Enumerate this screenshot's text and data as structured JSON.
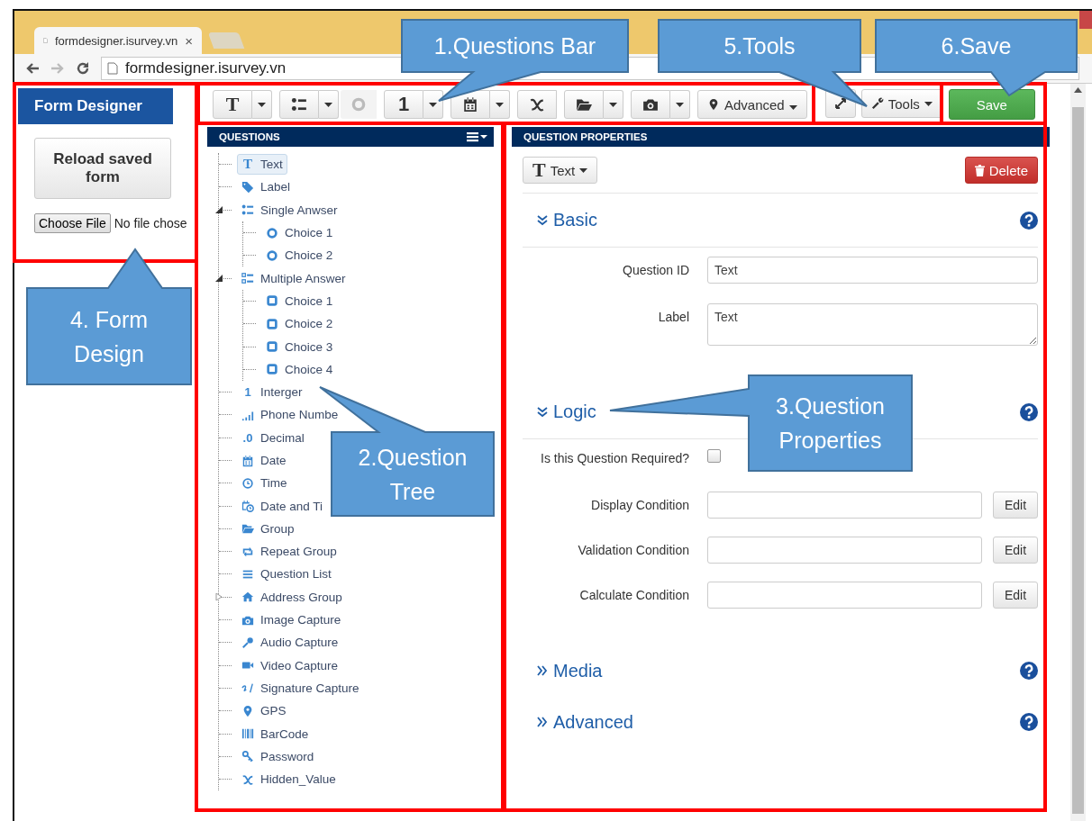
{
  "browser": {
    "tab_title": "formdesigner.isurvey.vn",
    "tab_close": "×",
    "address": "formdesigner.isurvey.vn"
  },
  "sidebar": {
    "title": "Form Designer",
    "reload_button": "Reload saved form",
    "file_button": "Choose File",
    "file_status": "No file chose"
  },
  "toolbar": {
    "buttons": [
      {
        "kind": "text",
        "glyph": "T",
        "dropdown": true,
        "disabled": false
      },
      {
        "kind": "single",
        "dropdown": true,
        "disabled": false
      },
      {
        "kind": "radio",
        "dropdown": false,
        "disabled": true
      },
      {
        "kind": "integer",
        "glyph": "1",
        "dropdown": true,
        "disabled": false
      },
      {
        "kind": "date",
        "dropdown": true,
        "disabled": false
      },
      {
        "kind": "hidden",
        "dropdown": false,
        "disabled": false
      },
      {
        "kind": "group",
        "dropdown": true,
        "disabled": false
      },
      {
        "kind": "image",
        "dropdown": true,
        "disabled": false
      },
      {
        "kind": "gps",
        "label": "Advanced",
        "dropdown": true,
        "disabled": false
      }
    ],
    "tools_label": "Tools",
    "save_label": "Save"
  },
  "questions": {
    "title": "QUESTIONS",
    "items": [
      {
        "kind": "text",
        "glyph": "T",
        "label": "Text",
        "selected": true
      },
      {
        "kind": "label",
        "label": "Label",
        "selected": false
      },
      {
        "kind": "single",
        "label": "Single Anwser",
        "selected": false,
        "expanded": true,
        "children": [
          {
            "kind": "radio",
            "label": "Choice 1",
            "selected": false
          },
          {
            "kind": "radio",
            "label": "Choice 2",
            "selected": false
          }
        ]
      },
      {
        "kind": "multiple",
        "label": "Multiple Answer",
        "selected": false,
        "expanded": true,
        "children": [
          {
            "kind": "checkbox",
            "label": "Choice 1",
            "selected": false
          },
          {
            "kind": "checkbox",
            "label": "Choice 2",
            "selected": false
          },
          {
            "kind": "checkbox",
            "label": "Choice 3",
            "selected": false
          },
          {
            "kind": "checkbox",
            "label": "Choice 4",
            "selected": false
          }
        ]
      },
      {
        "kind": "integer",
        "glyph": "1",
        "label": "Interger",
        "selected": false
      },
      {
        "kind": "phone",
        "label": "Phone Numbe",
        "selected": false
      },
      {
        "kind": "decimal",
        "glyph": ".0",
        "label": "Decimal",
        "selected": false
      },
      {
        "kind": "date",
        "label": "Date",
        "selected": false
      },
      {
        "kind": "time",
        "label": "Time",
        "selected": false
      },
      {
        "kind": "datetime",
        "label": "Date and Ti",
        "selected": false
      },
      {
        "kind": "group",
        "label": "Group",
        "selected": false
      },
      {
        "kind": "repeat",
        "label": "Repeat Group",
        "selected": false
      },
      {
        "kind": "list",
        "label": "Question List",
        "selected": false
      },
      {
        "kind": "address",
        "label": "Address Group",
        "selected": false,
        "expanded": false
      },
      {
        "kind": "image",
        "label": "Image Capture",
        "selected": false
      },
      {
        "kind": "audio",
        "label": "Audio Capture",
        "selected": false
      },
      {
        "kind": "video",
        "label": "Video Capture",
        "selected": false
      },
      {
        "kind": "signature",
        "label": "Signature Capture",
        "selected": false
      },
      {
        "kind": "gps",
        "label": "GPS",
        "selected": false
      },
      {
        "kind": "barcode",
        "label": "BarCode",
        "selected": false
      },
      {
        "kind": "password",
        "label": "Password",
        "selected": false
      },
      {
        "kind": "hidden",
        "label": "Hidden_Value",
        "selected": false
      }
    ]
  },
  "properties": {
    "title": "QUESTION PROPERTIES",
    "type_button": {
      "glyph": "T",
      "label": "Text"
    },
    "delete_label": "Delete",
    "sections": [
      {
        "title": "Basic",
        "expanded": true,
        "fields": [
          {
            "kind": "input",
            "label": "Question ID",
            "value": "Text"
          },
          {
            "kind": "textarea",
            "label": "Label",
            "value": "Text"
          }
        ]
      },
      {
        "title": "Logic",
        "expanded": true,
        "fields": [
          {
            "kind": "checkbox",
            "label": "Is this Question Required?",
            "checked": false
          },
          {
            "kind": "condition",
            "label": "Display Condition",
            "button": "Edit"
          },
          {
            "kind": "condition",
            "label": "Validation Condition",
            "button": "Edit"
          },
          {
            "kind": "condition",
            "label": "Calculate Condition",
            "button": "Edit"
          }
        ]
      },
      {
        "title": "Media",
        "expanded": false
      },
      {
        "title": "Advanced",
        "expanded": false
      }
    ]
  },
  "annotations": [
    "1.Questions Bar",
    "5.Tools",
    "6.Save",
    "4. Form Design",
    "2.Question Tree",
    "3.Question Properties"
  ]
}
